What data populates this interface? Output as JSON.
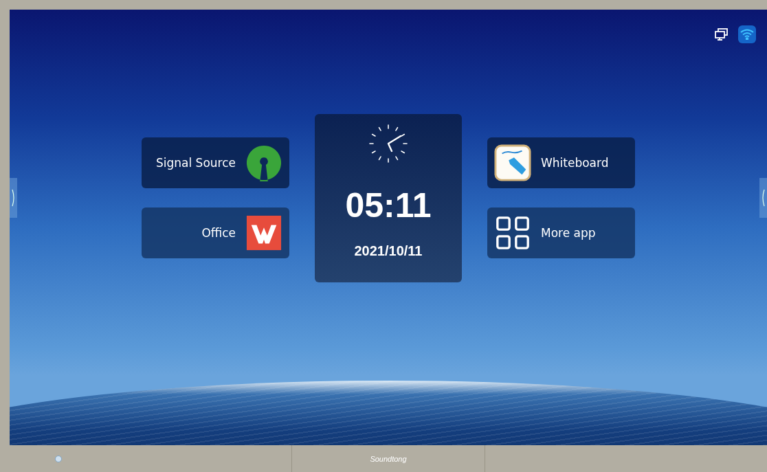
{
  "left_tiles": [
    {
      "label": "Signal Source",
      "kind": "signal"
    },
    {
      "label": "Office",
      "kind": "wps"
    }
  ],
  "clock": {
    "time": "05:11",
    "date": "2021/10/11"
  },
  "right_tiles": [
    {
      "label": "Whiteboard",
      "kind": "whiteboard"
    },
    {
      "label": "More app",
      "kind": "apps"
    }
  ],
  "bezel": {
    "logo": "Soundtong"
  }
}
